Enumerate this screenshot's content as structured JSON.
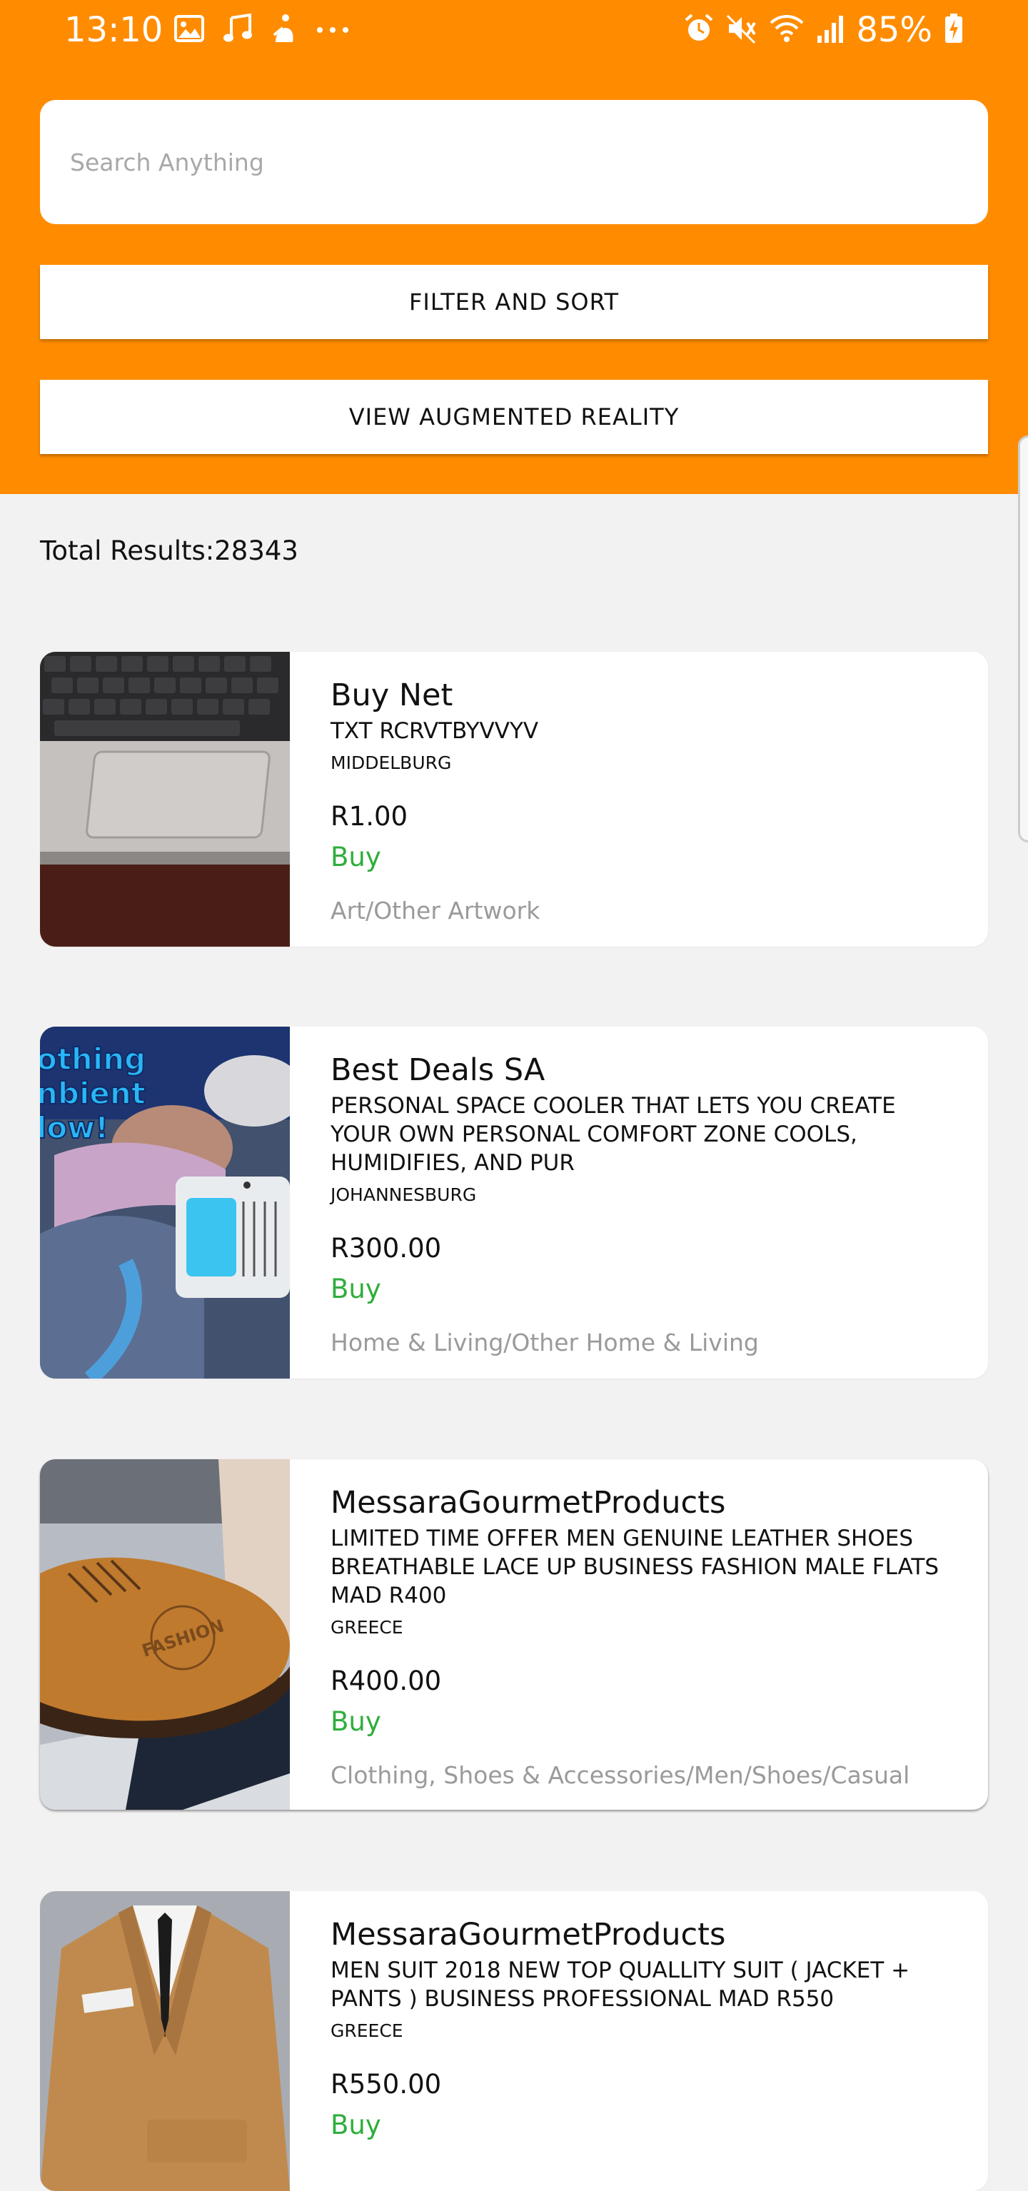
{
  "status_bar": {
    "time": "13:10",
    "left_icons": [
      "image-icon",
      "music-note-icon",
      "app-notification-icon",
      "more-dots-icon"
    ],
    "right_icons": [
      "alarm-icon",
      "mute-icon",
      "wifi-icon",
      "signal-icon"
    ],
    "battery_percent": "85%"
  },
  "search": {
    "placeholder": "Search Anything",
    "value": ""
  },
  "buttons": {
    "filter_sort": "FILTER AND SORT",
    "augmented_reality": "VIEW AUGMENTED REALITY"
  },
  "results": {
    "total_label": "Total Results:28343"
  },
  "colors": {
    "header_orange": "#ff8c00",
    "buy_green": "#2eae3a",
    "category_gray": "#9a9a9a",
    "page_background": "#f2f2f2"
  },
  "products": [
    {
      "shop": "Buy Net",
      "title": "TXT RCRVTBYVVYV",
      "location": "MIDDELBURG",
      "price": "R1.00",
      "buy_label": "Buy",
      "category": "Art/Other Artwork",
      "image_icon": "laptop-keyboard-image"
    },
    {
      "shop": "Best Deals SA",
      "title": "PERSONAL SPACE COOLER THAT LETS YOU CREATE YOUR OWN PERSONAL COMFORT ZONE COOLS, HUMIDIFIES, AND PUR",
      "location": "JOHANNESBURG",
      "price": "R300.00",
      "buy_label": "Buy",
      "category": "Home & Living/Other Home & Living",
      "image_icon": "space-cooler-image",
      "image_text": "othing\nnbient\nlow!"
    },
    {
      "shop": "MessaraGourmetProducts",
      "title": "LIMITED TIME OFFER MEN GENUINE LEATHER SHOES BREATHABLE LACE UP BUSINESS FASHION MALE FLATS MAD R400",
      "location": "GREECE",
      "price": "R400.00",
      "buy_label": "Buy",
      "category": "Clothing, Shoes & Accessories/Men/Shoes/Casual",
      "image_icon": "leather-shoe-image",
      "image_text": "FASHION"
    },
    {
      "shop": "MessaraGourmetProducts",
      "title": "MEN SUIT 2018 NEW TOP QUALLITY SUIT ( JACKET + PANTS ) BUSINESS PROFESSIONAL MAD R550",
      "location": "GREECE",
      "price": "R550.00",
      "buy_label": "Buy",
      "category": "",
      "image_icon": "business-suit-image"
    }
  ]
}
